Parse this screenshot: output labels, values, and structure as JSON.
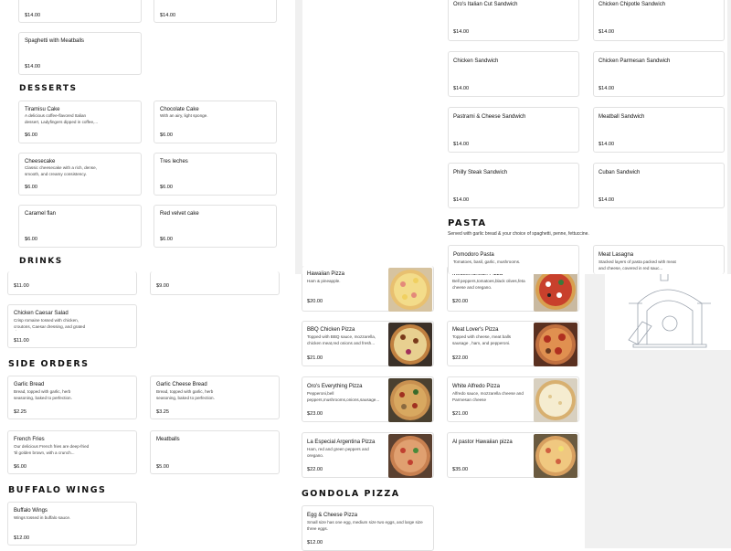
{
  "top": {
    "price_a": "$14.00",
    "price_b": "$14.00",
    "spaghetti": {
      "name": "Spaghetti with Meatballs",
      "price": "$14.00"
    }
  },
  "desserts": {
    "heading": "DESSERTS",
    "items": [
      {
        "name": "Tiramisu Cake",
        "desc": "A delicious coffee-flavored Italian dessert, Ladyfingers dipped in coffee,...",
        "price": "$6.00"
      },
      {
        "name": "Chocolate Cake",
        "desc": "With an airy, light sponge.",
        "price": "$6.00"
      },
      {
        "name": "Cheesecake",
        "desc": "Classic cheesecake with a rich, dense, smooth, and creamy consistency.",
        "price": "$6.00"
      },
      {
        "name": "Tres leches",
        "desc": "",
        "price": "$6.00"
      },
      {
        "name": "Caramel flan",
        "desc": "",
        "price": "$6.00"
      },
      {
        "name": "Red velvet cake",
        "desc": "",
        "price": "$6.00"
      }
    ]
  },
  "drinks": {
    "heading": "DRINKS",
    "price_a": "$11.00",
    "price_b": "$9.00"
  },
  "salad": {
    "name": "Chicken Caesar Salad",
    "desc": "Crisp romaine tossed with chicken, croutons, Caesar dressing, and grated cheese.",
    "price": "$11.00"
  },
  "side_orders": {
    "heading": "SIDE ORDERS",
    "items": [
      {
        "name": "Garlic Bread",
        "desc": "Bread, topped with garlic, herb seasoning, baked to perfection.",
        "price": "$2.25"
      },
      {
        "name": "Garlic Cheese Bread",
        "desc": "Bread, topped with garlic, herb seasoning, baked to perfection.",
        "price": "$3.25"
      },
      {
        "name": "French Fries",
        "desc": "Our delicious French fries are deep-fried 'til golden brown, with a crunch...",
        "price": "$6.00"
      },
      {
        "name": "Meatballs",
        "desc": "",
        "price": "$5.00"
      }
    ]
  },
  "buffalo_wings": {
    "heading": "BUFFALO WINGS",
    "item": {
      "name": "Buffalo Wings",
      "desc": "Wings tossed in buffalo sauce.",
      "price": "$12.00"
    }
  },
  "sandwiches": [
    {
      "name": "Oro's Italian Cut Sandwich",
      "price": "$14.00"
    },
    {
      "name": "Chicken Chipotle Sandwich",
      "price": "$14.00"
    },
    {
      "name": "Chicken Sandwich",
      "price": "$14.00"
    },
    {
      "name": "Chicken Parmesan Sandwich",
      "price": "$14.00"
    },
    {
      "name": "Pastrami & Cheese Sandwich",
      "price": "$14.00"
    },
    {
      "name": "Meatball Sandwich",
      "price": "$14.00"
    },
    {
      "name": "Philly Steak Sandwich",
      "price": "$14.00"
    },
    {
      "name": "Cuban Sandwich",
      "price": "$14.00"
    }
  ],
  "pasta": {
    "heading": "PASTA",
    "desc": "Served with garlic bread & your choice of spaghetti, penne, fettuccine.",
    "items": [
      {
        "name": "Pomodoro Pasta",
        "desc": "Tomatoes, basil, garlic, mushrooms."
      },
      {
        "name": "Meat Lasagna",
        "desc": "Stacked layers of pasta packed with meat and cheese, covered in red sauc..."
      }
    ]
  },
  "pizzas": [
    {
      "name": "Hawaiian Pizza",
      "desc": "Ham & pineapple.",
      "price": "$20.00"
    },
    {
      "name": "Mediterranean Pizza",
      "desc": "Bell peppers,tomatoes,black olives,feta cheese and oregano.",
      "price": "$20.00"
    },
    {
      "name": "BBQ Chicken Pizza",
      "desc": "Topped with BBQ sauce, mozzarella, chicken meat,red onions and fresh...",
      "price": "$21.00"
    },
    {
      "name": "Meat Lover's Pizza",
      "desc": "Topped with cheese, meat balls sausage , ham, and pepperoni.",
      "price": "$22.00"
    },
    {
      "name": "Oro's Everything Pizza",
      "desc": "Pepperoni,bell peppers,mushrooms,onions,sausage...",
      "price": "$23.00"
    },
    {
      "name": "White Alfredo Pizza",
      "desc": "Alfredo sauce, mozzarella cheese and Parmesan cheese",
      "price": "$21.00"
    },
    {
      "name": "La Especial Argentina Pizza",
      "desc": "Ham, red and green peppers and oregano.",
      "price": "$22.00"
    },
    {
      "name": "Al pastor Hawaiian pizza",
      "desc": "",
      "price": "$35.00"
    }
  ],
  "gondola": {
    "heading": "GONDOLA PIZZA",
    "item": {
      "name": "Egg & Cheese Pizza",
      "desc": "Small size has one egg, medium size two eggs, and large size three eggs.",
      "price": "$12.00"
    }
  },
  "colors": {
    "accent": "#111111",
    "placeholder_bg": "#f0f0f0",
    "card_border": "#e1e1e1"
  },
  "icons": [
    "pizza-oven-illustration",
    "pizza-photo"
  ]
}
